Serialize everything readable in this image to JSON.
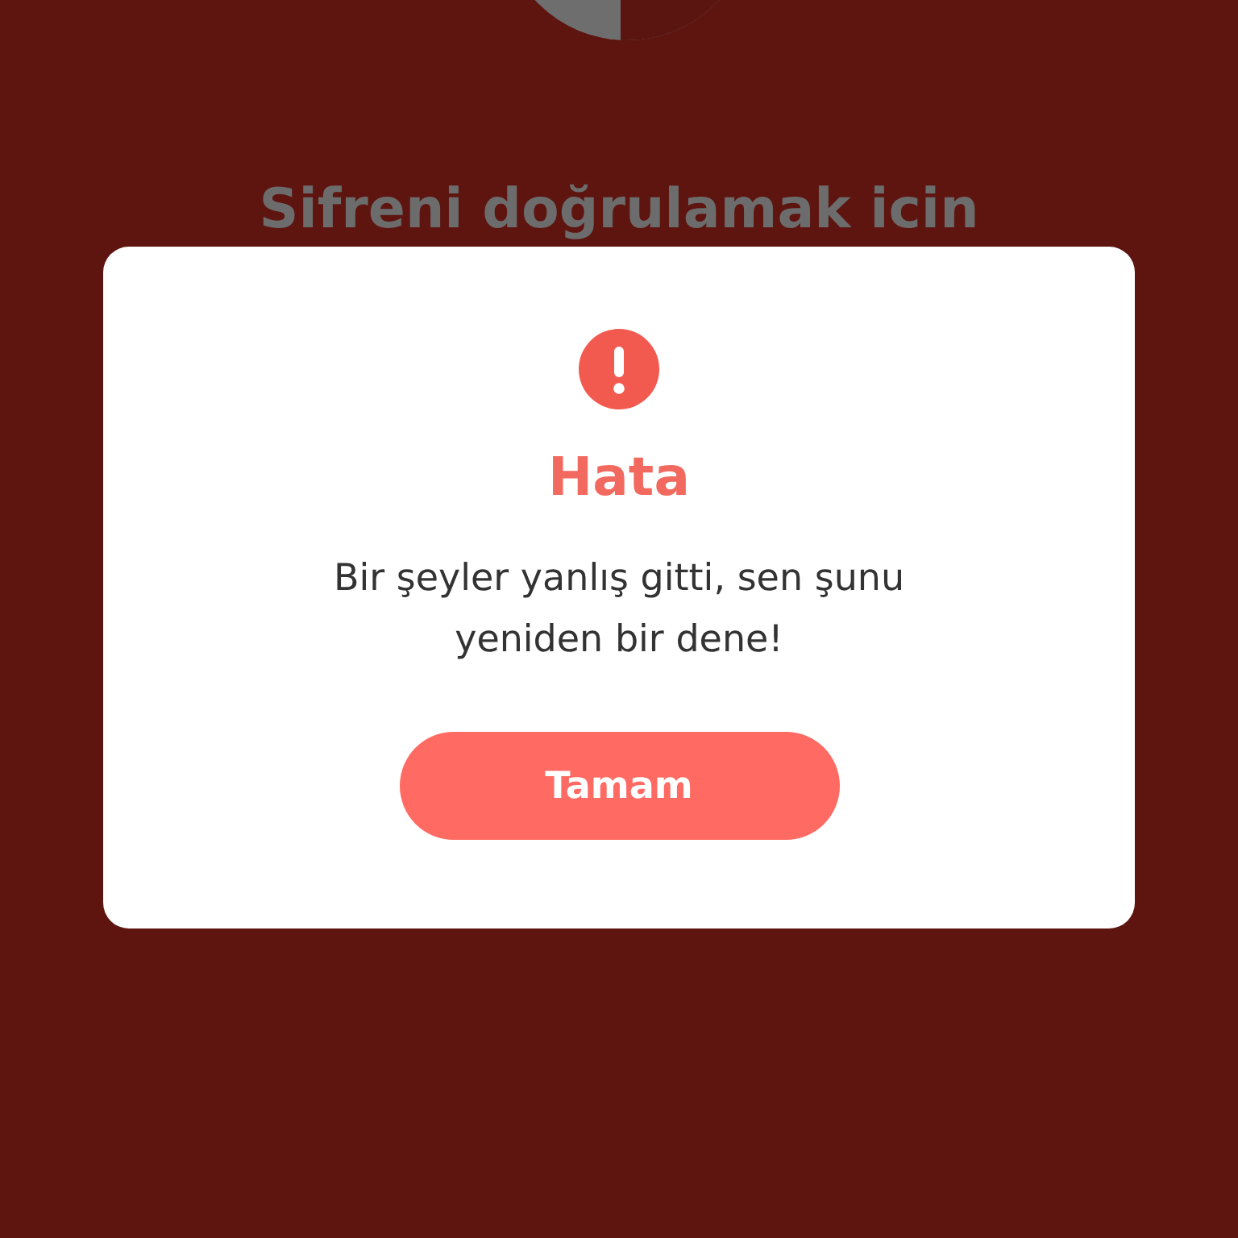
{
  "background": {
    "heading": "Sifreni doğrulamak icin"
  },
  "dialog": {
    "title": "Hata",
    "message": "Bir şeyler yanlış gitti, sen şunu yeniden bir dene!",
    "buttons": [
      "Tamam"
    ]
  }
}
